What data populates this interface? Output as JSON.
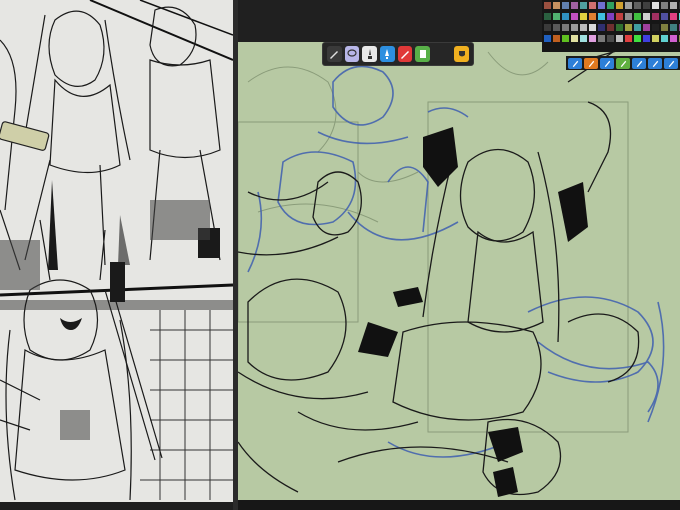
{
  "app": {
    "reference_panel": {
      "name": "reference-manga-page"
    },
    "canvas": {
      "name": "main-drawing-canvas",
      "paper_color": "#b7c9a3",
      "sketch_color": "#3f5fb0"
    }
  },
  "brush_toolbar": {
    "tools": [
      {
        "name": "pencil-icon",
        "bg": "#3a3a3a",
        "fg": "#e0e0e0"
      },
      {
        "name": "lasso-icon",
        "bg": "#b8b6e8",
        "fg": "#333333"
      },
      {
        "name": "brush-icon",
        "bg": "#e8e8e8",
        "fg": "#333333"
      },
      {
        "name": "pen-icon",
        "bg": "#2d8fe0",
        "fg": "#ffffff"
      },
      {
        "name": "marker-icon",
        "bg": "#e03838",
        "fg": "#ffffff"
      },
      {
        "name": "eraser-icon",
        "bg": "#58b048",
        "fg": "#ffffff"
      },
      {
        "name": "fill-icon",
        "bg": "#f0b020",
        "fg": "#333333"
      }
    ]
  },
  "palette": {
    "row1": [
      "#9a5040",
      "#c89060",
      "#6080b0",
      "#a060a0",
      "#50a0a0",
      "#d07070",
      "#7070d0",
      "#30a060",
      "#d0a030",
      "#a0a0a0",
      "#606060",
      "#404040",
      "#e0e0e0",
      "#808080",
      "#b0b0b0",
      "#303030"
    ],
    "row2": [
      "#2a6040",
      "#50b070",
      "#3090c0",
      "#c050c0",
      "#e0d040",
      "#e08030",
      "#40c0e0",
      "#8040c0",
      "#c04040",
      "#909090",
      "#40c040",
      "#d0d0d0",
      "#a03060",
      "#5050a0",
      "#e04080",
      "#60e0e0"
    ],
    "row3": [
      "#3a3a3a",
      "#5a5a5a",
      "#7a7a7a",
      "#9a9a9a",
      "#bababa",
      "#dadada",
      "#303070",
      "#703030",
      "#307030",
      "#a0a040",
      "#40a0a0",
      "#a040a0",
      "#202020",
      "#808040",
      "#408080",
      "#804080"
    ],
    "row4": [
      "#2060c0",
      "#c06020",
      "#60c020",
      "#e0e0a0",
      "#a0e0e0",
      "#e0a0e0",
      "#7a7a7a",
      "#4a4a4a",
      "#c0c0c0",
      "#e04040",
      "#40e040",
      "#4040e0",
      "#d0d060",
      "#60d0d0",
      "#d060d0",
      "#909050"
    ]
  },
  "brush_presets": [
    {
      "name": "brush-preset-1-icon",
      "color": "#2d7fd8"
    },
    {
      "name": "brush-preset-2-icon",
      "color": "#e07a20"
    },
    {
      "name": "brush-preset-3-icon",
      "color": "#2d7fd8"
    },
    {
      "name": "brush-preset-4-icon",
      "color": "#60b040"
    },
    {
      "name": "brush-preset-5-icon",
      "color": "#2d7fd8"
    },
    {
      "name": "brush-preset-6-icon",
      "color": "#2d7fd8"
    },
    {
      "name": "brush-preset-7-icon",
      "color": "#2d7fd8"
    }
  ]
}
